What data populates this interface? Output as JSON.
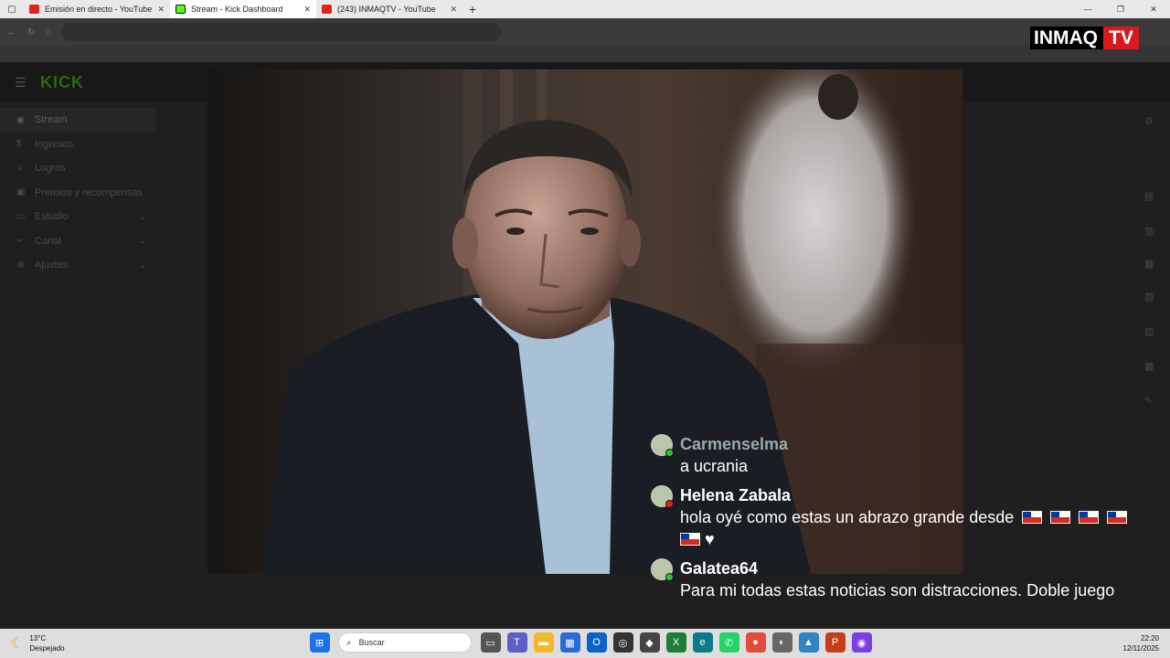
{
  "browser": {
    "tabs": [
      {
        "title": "Emisión en directo - YouTube Stu",
        "favicon": "youtube-icon",
        "active": false
      },
      {
        "title": "Stream - Kick Dashboard",
        "favicon": "kick-icon",
        "active": true
      },
      {
        "title": "(243) INMAQTV - YouTube",
        "favicon": "youtube-icon",
        "active": false
      }
    ],
    "new_tab": "+",
    "window_controls": [
      "—",
      "❐",
      "✕"
    ]
  },
  "brand": {
    "part1": "INMAQ",
    "part2": "TV",
    "accent": "#d71920"
  },
  "dashboard": {
    "logo": "KICK",
    "sidebar": [
      {
        "label": "Stream",
        "icon": "broadcast-icon",
        "chevron": false
      },
      {
        "label": "Ingresos",
        "icon": "dollar-icon",
        "chevron": false
      },
      {
        "label": "Logros",
        "icon": "trophy-icon",
        "chevron": false
      },
      {
        "label": "Premios y recompensas",
        "icon": "gift-icon",
        "chevron": false
      },
      {
        "label": "Estudio",
        "icon": "studio-icon",
        "chevron": true
      },
      {
        "label": "Canal",
        "icon": "channel-icon",
        "chevron": true
      },
      {
        "label": "Ajustes",
        "icon": "gear-icon",
        "chevron": true
      }
    ]
  },
  "chat": [
    {
      "username": "Carmenselma",
      "text": "a ucrania",
      "badge": "green",
      "faded": true
    },
    {
      "username": "Helena Zabala",
      "text": "hola oyé como estas un abrazo grande desde",
      "badge": "red",
      "faded": false,
      "flags": 5,
      "suffix": "♥"
    },
    {
      "username": "Galatea64",
      "text": "Para mi todas estas noticias son distracciones. Doble juego",
      "badge": "green",
      "faded": false
    }
  ],
  "taskbar": {
    "weather": {
      "temp": "13°C",
      "condition": "Despejado"
    },
    "search_placeholder": "Buscar",
    "time": "22:20",
    "date": "12/11/2025"
  }
}
